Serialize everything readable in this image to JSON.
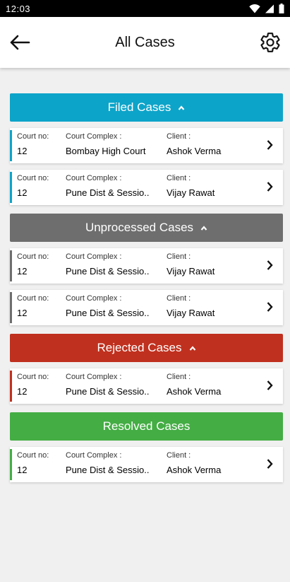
{
  "status": {
    "time": "12:03"
  },
  "header": {
    "title": "All Cases"
  },
  "labels": {
    "court_no": "Court no:",
    "court_complex": "Court Complex :",
    "client": "Client :"
  },
  "sections": [
    {
      "title": "Filed Cases",
      "color": "#0da4c9",
      "expanded": true,
      "cases": [
        {
          "court_no": "12",
          "court_complex": "Bombay High Court",
          "client": "Ashok Verma"
        },
        {
          "court_no": "12",
          "court_complex": "Pune Dist & Sessio..",
          "client": "Vijay Rawat"
        }
      ]
    },
    {
      "title": "Unprocessed Cases",
      "color": "#6e6e6e",
      "expanded": true,
      "cases": [
        {
          "court_no": "12",
          "court_complex": "Pune Dist & Sessio..",
          "client": "Vijay Rawat"
        },
        {
          "court_no": "12",
          "court_complex": "Pune Dist & Sessio..",
          "client": "Vijay Rawat"
        }
      ]
    },
    {
      "title": "Rejected Cases",
      "color": "#c0301e",
      "expanded": true,
      "cases": [
        {
          "court_no": "12",
          "court_complex": "Pune Dist & Sessio..",
          "client": "Ashok Verma"
        }
      ]
    },
    {
      "title": "Resolved Cases",
      "color": "#44ad44",
      "expanded": false,
      "cases": [
        {
          "court_no": "12",
          "court_complex": "Pune Dist & Sessio..",
          "client": "Ashok Verma"
        }
      ]
    }
  ]
}
